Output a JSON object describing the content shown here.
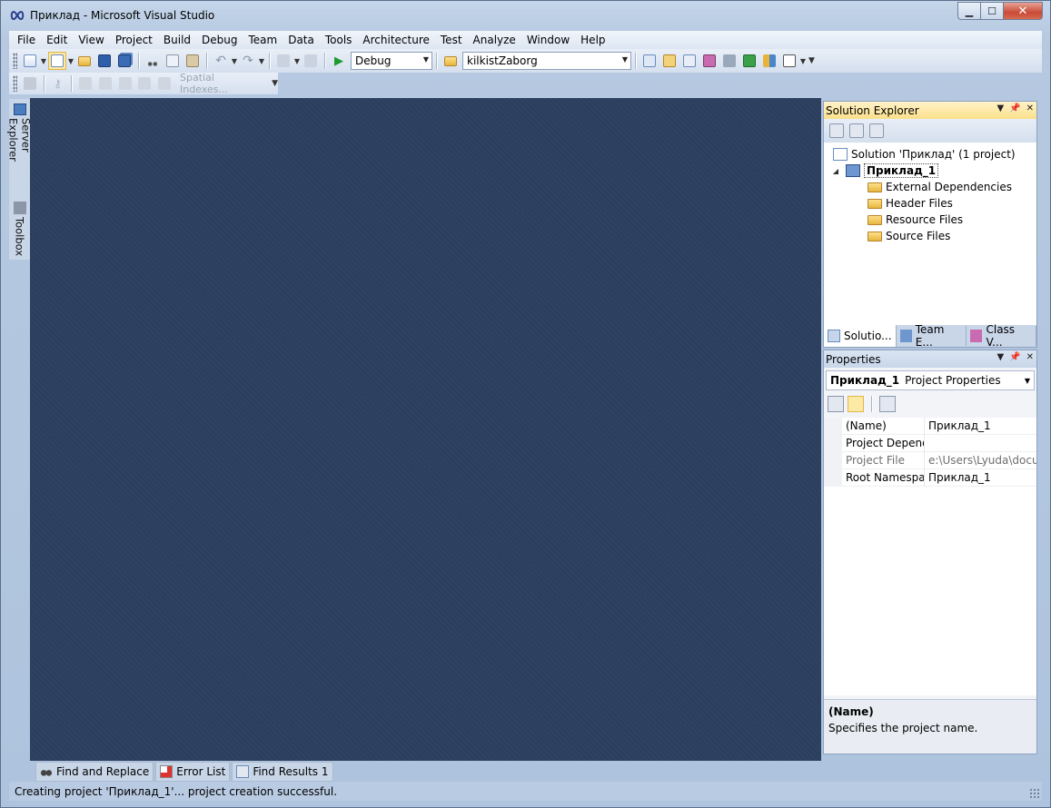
{
  "window": {
    "title": "Приклад - Microsoft Visual Studio",
    "icon": "visual-studio-infinity-icon",
    "minimize_label": "▁",
    "maximize_label": "☐",
    "close_label": "✕"
  },
  "menu": [
    "File",
    "Edit",
    "View",
    "Project",
    "Build",
    "Debug",
    "Team",
    "Data",
    "Tools",
    "Architecture",
    "Test",
    "Analyze",
    "Window",
    "Help"
  ],
  "toolbar": {
    "config_value": "Debug",
    "platform_value": "kilkistZaborg",
    "spatial_indexes_label": "Spatial Indexes..."
  },
  "left_dock": {
    "server_explorer": "Server Explorer",
    "toolbox": "Toolbox"
  },
  "solution_explorer": {
    "title": "Solution Explorer",
    "solution_label": "Solution 'Приклад' (1 project)",
    "project_label": "Приклад_1",
    "children": [
      "External Dependencies",
      "Header Files",
      "Resource Files",
      "Source Files"
    ],
    "tabs": [
      "Solutio...",
      "Team E...",
      "Class V..."
    ]
  },
  "properties": {
    "title": "Properties",
    "object_name": "Приклад_1",
    "object_type": "Project Properties",
    "rows": [
      {
        "name": "(Name)",
        "value": "Приклад_1",
        "disabled": false
      },
      {
        "name": "Project Depende",
        "value": "",
        "disabled": false
      },
      {
        "name": "Project File",
        "value": "e:\\Users\\Lyuda\\docun",
        "disabled": true
      },
      {
        "name": "Root Namespace",
        "value": "Приклад_1",
        "disabled": false
      }
    ],
    "description_title": "(Name)",
    "description_text": "Specifies the project name."
  },
  "bottom_tabs": [
    "Find and Replace",
    "Error List",
    "Find Results 1"
  ],
  "status": {
    "text": "Creating project 'Приклад_1'... project creation successful."
  },
  "colors": {
    "editor_background": "#2c3e5e",
    "title_active_panel": "#fbe08a"
  }
}
